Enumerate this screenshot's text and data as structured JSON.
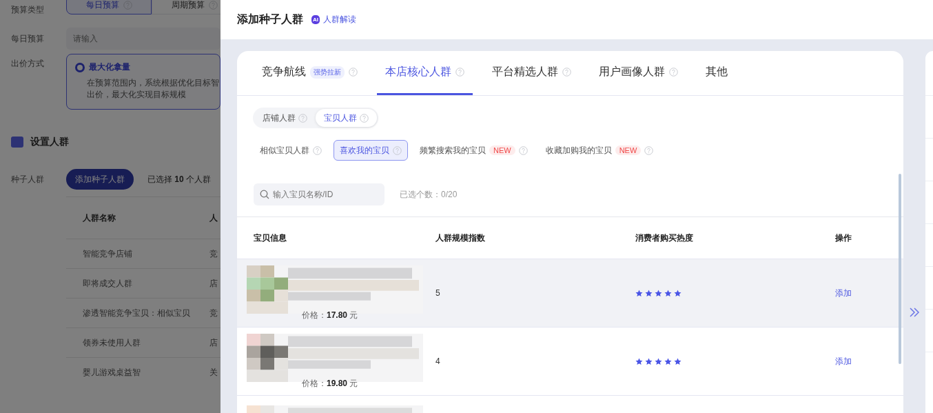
{
  "background_form": {
    "budget_type": {
      "label": "预算类型",
      "options": [
        {
          "label": "每日预算",
          "selected": true
        },
        {
          "label": "周期预算",
          "selected": false
        }
      ]
    },
    "daily_budget": {
      "label": "每日预算",
      "placeholder": "请输入"
    },
    "bid_method": {
      "label": "出价方式",
      "option": {
        "title": "最大化拿量",
        "selected": true,
        "description_lines": [
          "在预算范围内，系统根据优化目标智",
          "出价，最大化实现目标规模"
        ]
      }
    },
    "section_title": "设置人群",
    "seed_audience": {
      "label": "种子人群",
      "button": "添加种子人群",
      "selected_count": "已选择 **10** 个人群"
    },
    "table": {
      "columns": [
        "人群名称",
        "人"
      ],
      "rows": [
        [
          "智能竞争店铺",
          "竞"
        ],
        [
          "即将成交人群",
          "店"
        ],
        [
          "渗透智能竞争宝贝：相似宝贝",
          "竞"
        ],
        [
          "领券未使用人群",
          "店"
        ],
        [
          "婴儿游戏桌益智",
          "关"
        ]
      ]
    }
  },
  "drawer": {
    "title": "添加种子人群",
    "ai_badge": "AI",
    "ai_link": "人群解读",
    "tabs": [
      {
        "label": "竞争航线",
        "badge": "强势拉新",
        "help": true,
        "selected": false
      },
      {
        "label": "本店核心人群",
        "help": true,
        "selected": true
      },
      {
        "label": "平台精选人群",
        "help": true,
        "selected": false
      },
      {
        "label": "用户画像人群",
        "help": true,
        "selected": false
      },
      {
        "label": "其他",
        "help": false,
        "selected": false
      }
    ],
    "scope": [
      {
        "label": "店铺人群",
        "selected": false
      },
      {
        "label": "宝贝人群",
        "selected": true
      }
    ],
    "filters": [
      {
        "label": "相似宝贝人群",
        "selected": false
      },
      {
        "label": "喜欢我的宝贝",
        "selected": true
      },
      {
        "label": "频繁搜索我的宝贝",
        "badge": "NEW",
        "selected": false
      },
      {
        "label": "收藏加购我的宝贝",
        "badge": "NEW",
        "selected": false
      }
    ],
    "search": {
      "placeholder": "输入宝贝名称/ID"
    },
    "selected_count": "已选个数：0/20",
    "table": {
      "columns": [
        "宝贝信息",
        "人群规模指数",
        "消费者购买热度",
        "操作"
      ],
      "rows": [
        {
          "highlighted": true,
          "price": "价格：**17.80** 元",
          "scale": "5",
          "stars": 5,
          "action": "添加"
        },
        {
          "highlighted": false,
          "price": "价格：**19.80** 元",
          "scale": "4",
          "stars": 5,
          "action": "添加"
        },
        {
          "highlighted": false
        }
      ]
    }
  }
}
